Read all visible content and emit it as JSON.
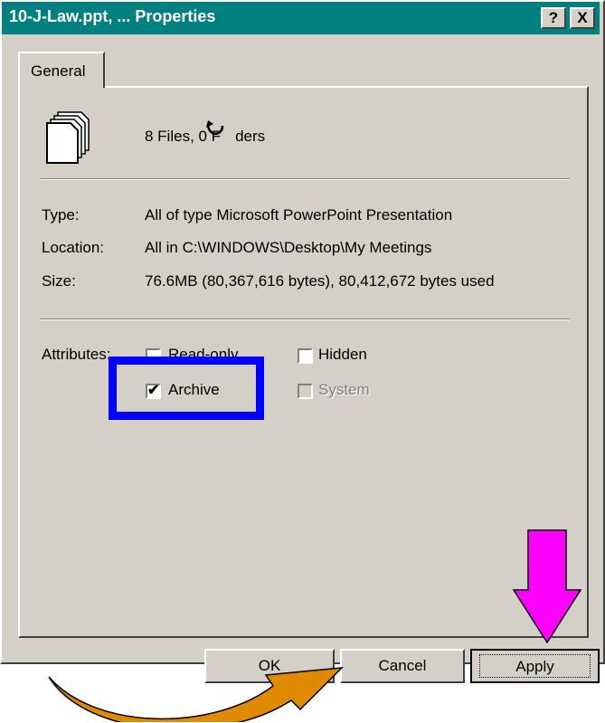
{
  "window": {
    "title": "10-J-Law.ppt, ... Properties",
    "help_button": "?",
    "close_button": "X"
  },
  "tabs": [
    {
      "label": "General",
      "selected": true
    }
  ],
  "summary": {
    "count_text": "8 Files, 0 Folders",
    "count_visible_text": "8 Files, 0 F",
    "count_tail": "ders",
    "icon": "multiple-files-icon"
  },
  "properties": [
    {
      "label": "Type:",
      "value": "All of type Microsoft PowerPoint Presentation"
    },
    {
      "label": "Location:",
      "value": "All in C:\\WINDOWS\\Desktop\\My Meetings"
    },
    {
      "label": "Size:",
      "value": "76.6MB (80,367,616 bytes), 80,412,672 bytes used"
    }
  ],
  "attributes": {
    "label": "Attributes:",
    "items": [
      {
        "label": "Read-only",
        "checked": false,
        "disabled": false
      },
      {
        "label": "Hidden",
        "checked": false,
        "disabled": false
      },
      {
        "label": "Archive",
        "checked": true,
        "disabled": false
      },
      {
        "label": "System",
        "checked": false,
        "disabled": true
      }
    ]
  },
  "buttons": {
    "ok": "OK",
    "cancel": "Cancel",
    "apply": "Apply"
  },
  "annotations": {
    "highlight_color": "#0000ff",
    "down_arrow_color": "#ff00ff",
    "curved_arrow_color": "#e08a00"
  }
}
